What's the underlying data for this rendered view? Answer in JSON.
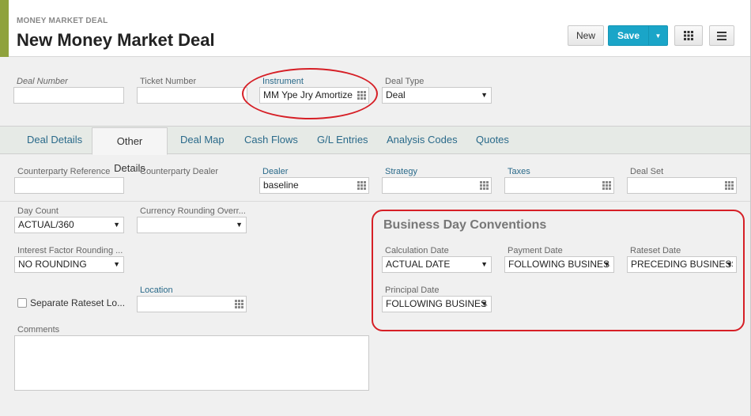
{
  "header": {
    "breadcrumb": "MONEY MARKET DEAL",
    "title": "New Money Market Deal",
    "new_label": "New",
    "save_label": "Save"
  },
  "top_fields": {
    "deal_number": {
      "label": "Deal Number",
      "value": ""
    },
    "ticket_number": {
      "label": "Ticket Number",
      "value": ""
    },
    "instrument": {
      "label": "Instrument",
      "value": "MM Ype Jry Amortize"
    },
    "deal_type": {
      "label": "Deal Type",
      "value": "Deal"
    }
  },
  "tabs": [
    "Deal Details",
    "Other Details",
    "Deal Map",
    "Cash Flows",
    "G/L Entries",
    "Analysis Codes",
    "Quotes"
  ],
  "active_tab": "Other Details",
  "other_details": {
    "counterparty_reference": {
      "label": "Counterparty Reference",
      "value": ""
    },
    "counterparty_dealer": {
      "label": "Counterparty Dealer"
    },
    "dealer": {
      "label": "Dealer",
      "value": "baseline"
    },
    "strategy": {
      "label": "Strategy",
      "value": ""
    },
    "taxes": {
      "label": "Taxes",
      "value": ""
    },
    "deal_set": {
      "label": "Deal Set",
      "value": ""
    },
    "day_count": {
      "label": "Day Count",
      "value": "ACTUAL/360"
    },
    "currency_rounding": {
      "label": "Currency Rounding Overr...",
      "value": ""
    },
    "interest_factor_rounding": {
      "label": "Interest Factor Rounding ...",
      "value": "NO ROUNDING"
    },
    "separate_rateset": {
      "label": "Separate Rateset Lo...",
      "checked": false
    },
    "location": {
      "label": "Location",
      "value": ""
    },
    "comments": {
      "label": "Comments",
      "value": ""
    }
  },
  "business_day_conventions": {
    "title": "Business Day Conventions",
    "calculation_date": {
      "label": "Calculation Date",
      "value": "ACTUAL DATE"
    },
    "payment_date": {
      "label": "Payment Date",
      "value": "FOLLOWING BUSINESS DAY"
    },
    "rateset_date": {
      "label": "Rateset Date",
      "value": "PRECEDING BUSINESS DAY"
    },
    "principal_date": {
      "label": "Principal Date",
      "value": "FOLLOWING BUSINESS DAY"
    }
  },
  "colors": {
    "accent": "#8fa23d",
    "save": "#1aa5c8",
    "annotation": "#d61f26"
  }
}
